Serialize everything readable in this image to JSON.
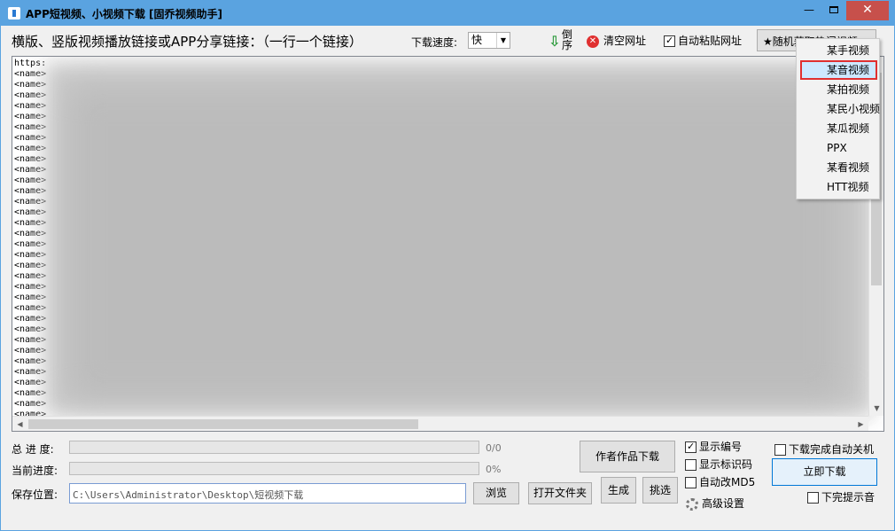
{
  "window": {
    "title": "APP短视频、小视频下载 [固乔视频助手]",
    "controls": {
      "minimize": "—",
      "close": "✕"
    }
  },
  "toolbar": {
    "links_label": "横版、竖版视频播放链接或APP分享链接：（一行一个链接）",
    "speed_label": "下载速度:",
    "speed_value": "快",
    "sort_label": "倒序",
    "clear_label": "清空网址",
    "autopaste_label": "自动粘贴网址",
    "autopaste_checked": true,
    "random_label": "★随机获取热门视频▲"
  },
  "editor": {
    "lines": [
      "https:",
      "<name>",
      "<name>",
      "<name>",
      "<name>",
      "<name>",
      "<name>",
      "<name>",
      "<name>",
      "<name>",
      "<name>",
      "<name>",
      "<name>",
      "<name>",
      "<name>",
      "<name>",
      "<name>",
      "<name>",
      "<name>",
      "<name>",
      "<name>",
      "<name>",
      "<name>",
      "<name>",
      "<name>",
      "<name>",
      "<name>",
      "<name>",
      "<name>",
      "<name>",
      "<name>",
      "<name>",
      "<name>",
      "<name>"
    ]
  },
  "progress": {
    "total_label": "总 进 度:",
    "total_value": "0/0",
    "total_fraction": 0,
    "current_label": "当前进度:",
    "current_value": "0%",
    "current_fraction": 0
  },
  "save": {
    "label": "保存位置:",
    "path": "C:\\Users\\Administrator\\Desktop\\短视频下载"
  },
  "buttons": {
    "browse": "浏览",
    "open_folder": "打开文件夹",
    "author_download": "作者作品下载",
    "generate": "生成",
    "pick": "挑选",
    "download_now": "立即下载"
  },
  "options": {
    "show_number": {
      "label": "显示编号",
      "checked": true
    },
    "show_id": {
      "label": "显示标识码",
      "checked": false
    },
    "auto_md5": {
      "label": "自动改MD5",
      "checked": false
    },
    "advanced": "高级设置",
    "shutdown": {
      "label": "下载完成自动关机",
      "checked": false
    },
    "sound": {
      "label": "下完提示音",
      "checked": false
    }
  },
  "dropdown": {
    "items": [
      "某手视频",
      "某音视频",
      "某拍视频",
      "某民小视频",
      "某瓜视频",
      "PPX",
      "某看视频",
      "HTT视频"
    ],
    "selected": 1
  },
  "colors": {
    "titlebar": "#5aa3e0",
    "close": "#c7504b",
    "highlight": "#e03030"
  }
}
